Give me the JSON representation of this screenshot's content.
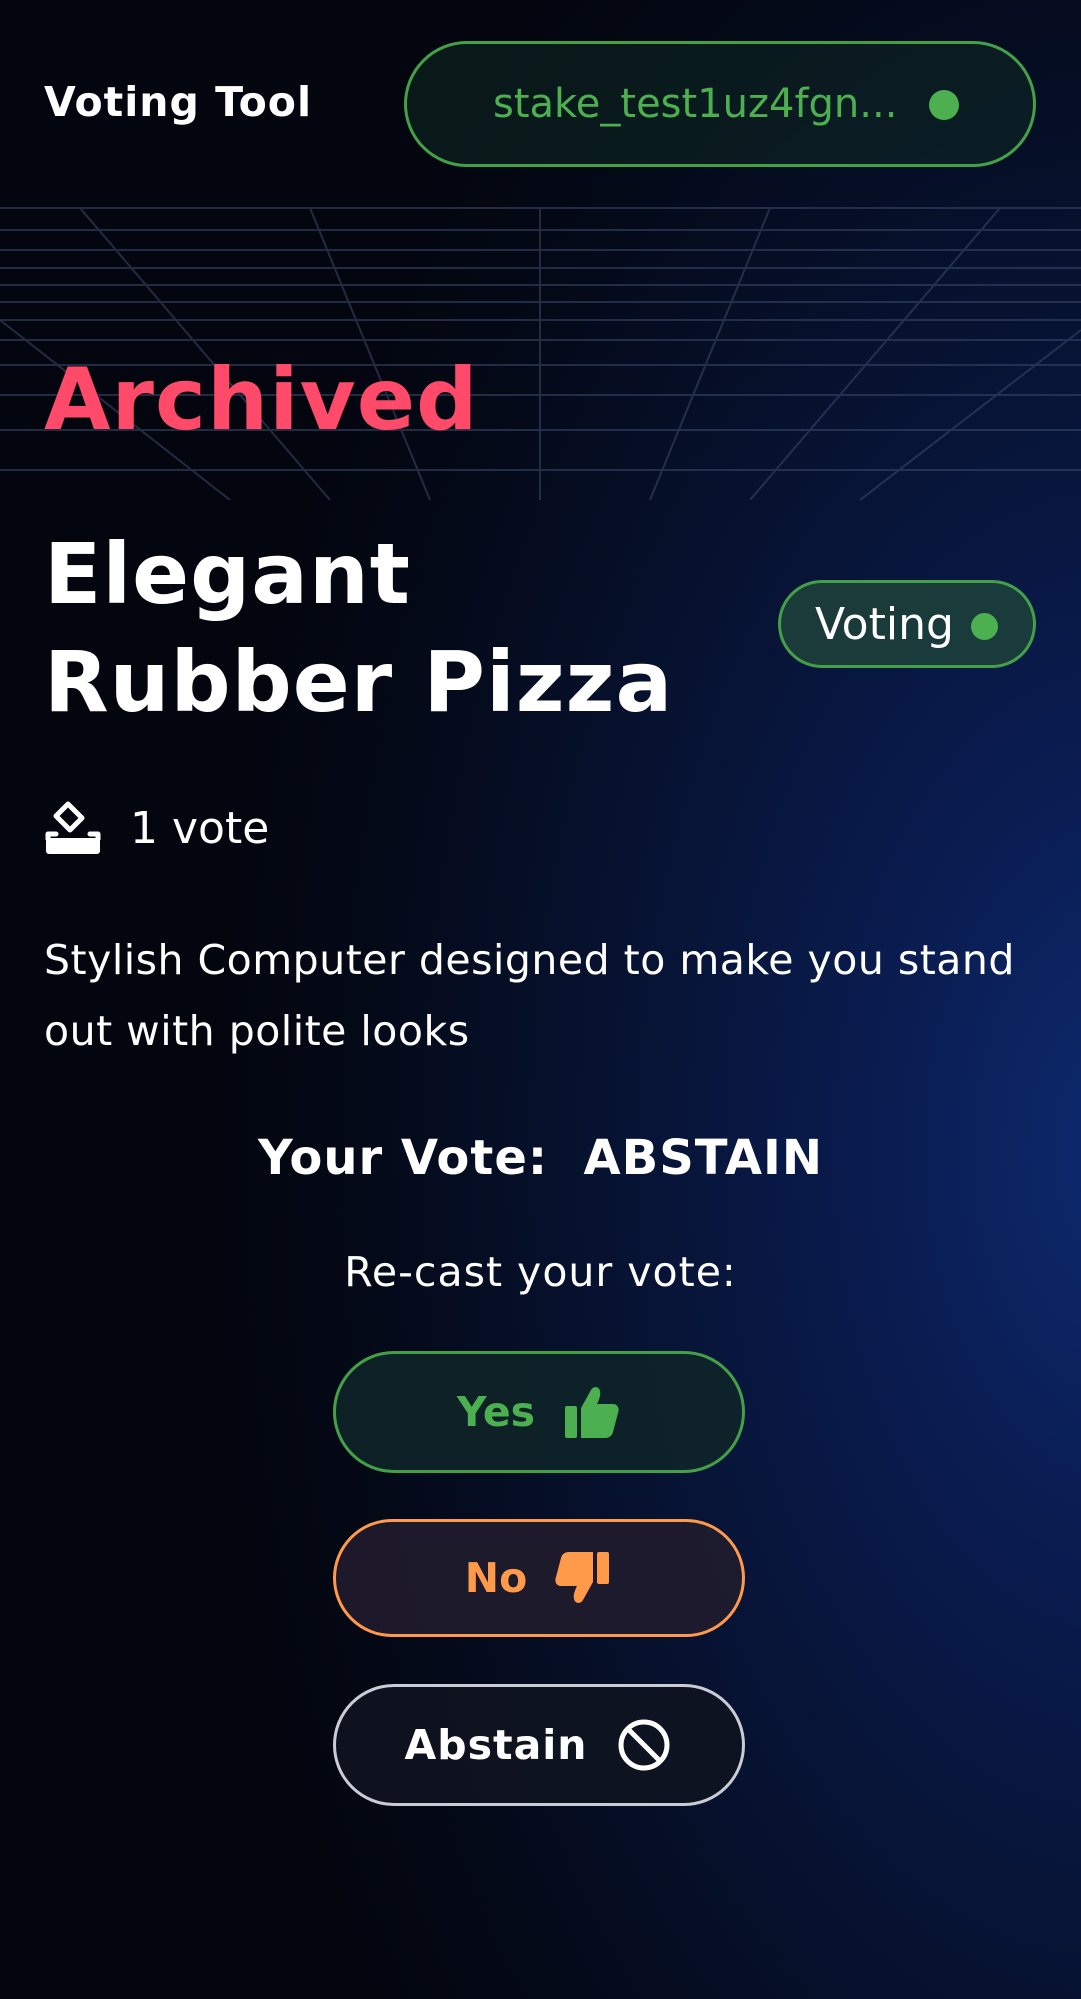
{
  "header": {
    "app_title": "Voting Tool",
    "wallet_address": "stake_test1uz4fgn...",
    "wallet_status_color": "#4caf50"
  },
  "proposal": {
    "state_label": "Archived",
    "state_color": "#ff4a6a",
    "title": "Elegant Rubber Pizza",
    "status_badge": "Voting",
    "vote_count": "1 vote",
    "description": "Stylish Computer designed to make you stand out with polite looks"
  },
  "your_vote": {
    "label": "Your Vote:  ABSTAIN"
  },
  "recast": {
    "label": "Re-cast your vote:",
    "yes_label": "Yes",
    "no_label": "No",
    "abstain_label": "Abstain"
  },
  "colors": {
    "yes": "#4caf50",
    "no": "#ff9a4a",
    "abstain": "#ffffff"
  },
  "icons": {
    "vote_count": "ballot-box-icon",
    "yes": "thumbs-up-icon",
    "no": "thumbs-down-icon",
    "abstain": "ban-icon"
  }
}
